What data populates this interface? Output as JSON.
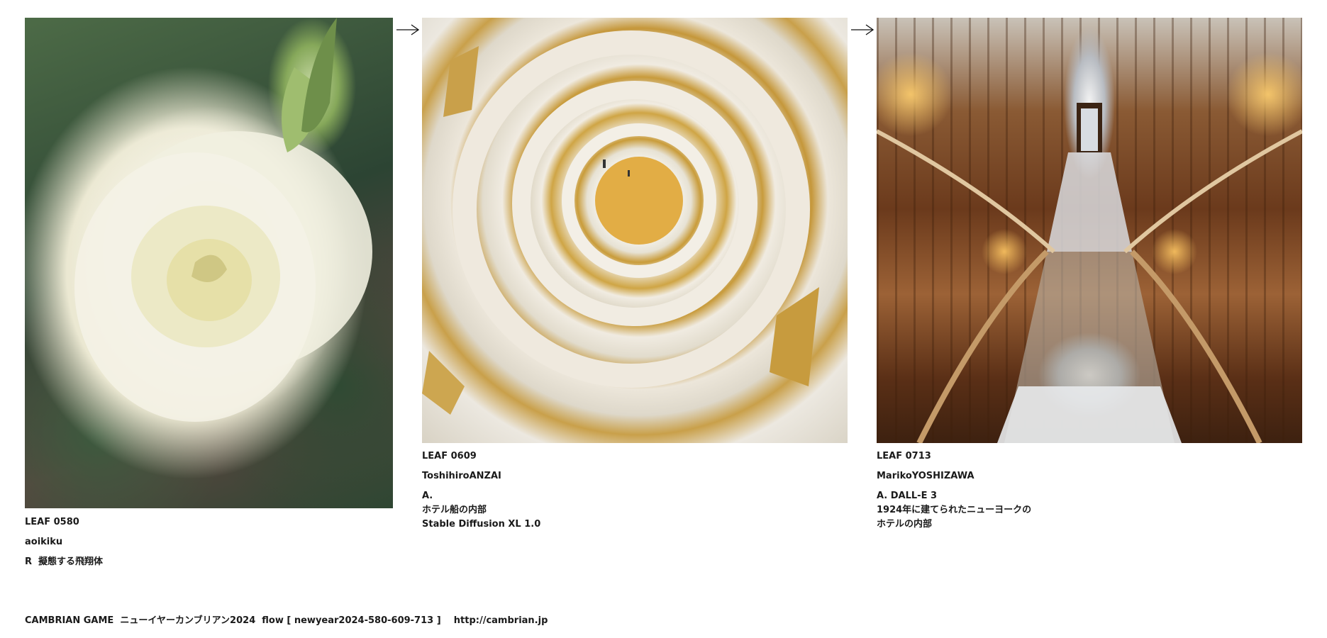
{
  "leaves": [
    {
      "id": "LEAF 0580",
      "author": "aoikiku",
      "lines": [
        "R  擬態する飛翔体"
      ]
    },
    {
      "id": "LEAF 0609",
      "author": "ToshihiroANZAI",
      "lines": [
        "A.",
        "ホテル船の内部",
        "Stable Diffusion XL 1.0"
      ]
    },
    {
      "id": "LEAF 0713",
      "author": "MarikoYOSHIZAWA",
      "lines": [
        "A. DALL-E 3",
        "1924年に建てられたニューヨークの",
        "ホテルの内部"
      ]
    }
  ],
  "footer": {
    "text": "CAMBRIAN GAME  ニューイヤーカンブリアン2024  flow [ newyear2024-580-609-713 ]    http://cambrian.jp"
  },
  "icons": {
    "arrow": "right-arrow-icon"
  }
}
